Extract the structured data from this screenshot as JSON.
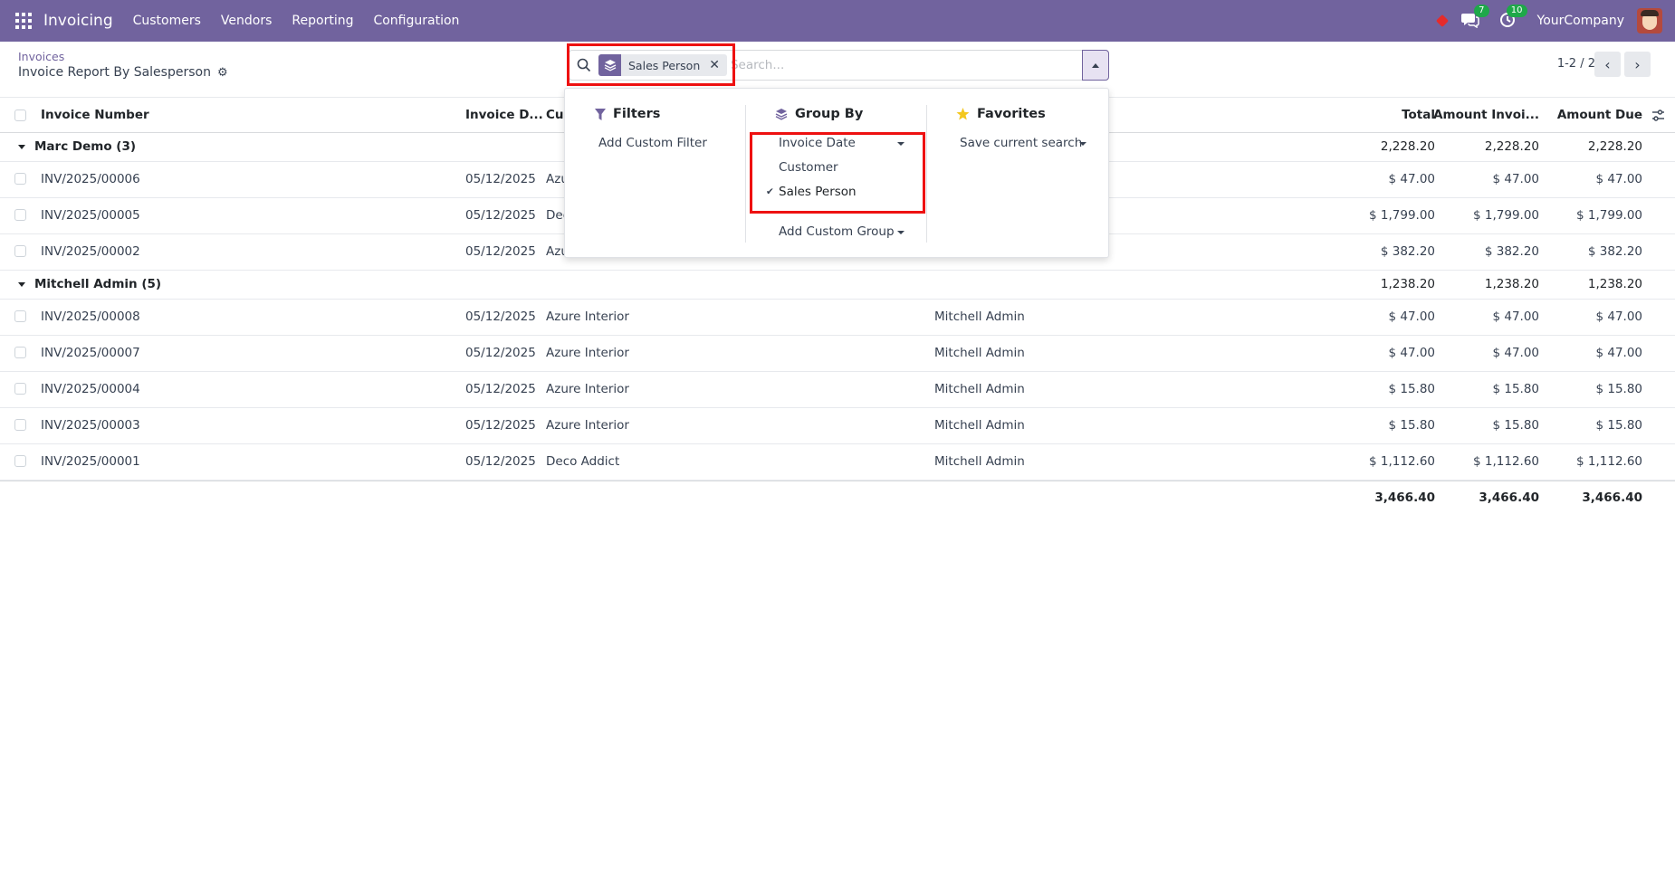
{
  "navbar": {
    "brand": "Invoicing",
    "menu": [
      "Customers",
      "Vendors",
      "Reporting",
      "Configuration"
    ],
    "messages_badge": "7",
    "activity_badge": "10",
    "company": "YourCompany",
    "color": "#71639e"
  },
  "control_panel": {
    "breadcrumb": "Invoices",
    "title": "Invoice Report By Salesperson",
    "search": {
      "facet_label": "Sales Person",
      "placeholder": "Search..."
    },
    "pager": "1-2 / 2"
  },
  "table": {
    "headers": {
      "invoice_number": "Invoice Number",
      "invoice_date": "Invoice D...",
      "customer": "Cus",
      "total": "Total",
      "amount_invoiced": "Amount Invoi...",
      "amount_due": "Amount Due"
    },
    "groups": [
      {
        "label": "Marc Demo (3)",
        "total": "2,228.20",
        "invoiced": "2,228.20",
        "due": "2,228.20",
        "rows": [
          {
            "number": "INV/2025/00006",
            "date": "05/12/2025",
            "customer": "Azu",
            "salesperson": "",
            "total": "$ 47.00",
            "invoiced": "$ 47.00",
            "due": "$ 47.00"
          },
          {
            "number": "INV/2025/00005",
            "date": "05/12/2025",
            "customer": "Dec",
            "salesperson": "",
            "total": "$ 1,799.00",
            "invoiced": "$ 1,799.00",
            "due": "$ 1,799.00"
          },
          {
            "number": "INV/2025/00002",
            "date": "05/12/2025",
            "customer": "Azu",
            "salesperson": "",
            "total": "$ 382.20",
            "invoiced": "$ 382.20",
            "due": "$ 382.20"
          }
        ]
      },
      {
        "label": "Mitchell Admin (5)",
        "total": "1,238.20",
        "invoiced": "1,238.20",
        "due": "1,238.20",
        "rows": [
          {
            "number": "INV/2025/00008",
            "date": "05/12/2025",
            "customer": "Azure Interior",
            "salesperson": "Mitchell Admin",
            "total": "$ 47.00",
            "invoiced": "$ 47.00",
            "due": "$ 47.00"
          },
          {
            "number": "INV/2025/00007",
            "date": "05/12/2025",
            "customer": "Azure Interior",
            "salesperson": "Mitchell Admin",
            "total": "$ 47.00",
            "invoiced": "$ 47.00",
            "due": "$ 47.00"
          },
          {
            "number": "INV/2025/00004",
            "date": "05/12/2025",
            "customer": "Azure Interior",
            "salesperson": "Mitchell Admin",
            "total": "$ 15.80",
            "invoiced": "$ 15.80",
            "due": "$ 15.80"
          },
          {
            "number": "INV/2025/00003",
            "date": "05/12/2025",
            "customer": "Azure Interior",
            "salesperson": "Mitchell Admin",
            "total": "$ 15.80",
            "invoiced": "$ 15.80",
            "due": "$ 15.80"
          },
          {
            "number": "INV/2025/00001",
            "date": "05/12/2025",
            "customer": "Deco Addict",
            "salesperson": "Mitchell Admin",
            "total": "$ 1,112.60",
            "invoiced": "$ 1,112.60",
            "due": "$ 1,112.60"
          }
        ]
      }
    ],
    "grand_total": {
      "total": "3,466.40",
      "invoiced": "3,466.40",
      "due": "3,466.40"
    }
  },
  "dropdown": {
    "filters": {
      "title": "Filters",
      "add_custom": "Add Custom Filter"
    },
    "group_by": {
      "title": "Group By",
      "options": [
        "Invoice Date",
        "Customer",
        "Sales Person"
      ],
      "selected": "Sales Person",
      "add_custom": "Add Custom Group"
    },
    "favorites": {
      "title": "Favorites",
      "save": "Save current search"
    }
  },
  "highlight_color": "#ee1111"
}
